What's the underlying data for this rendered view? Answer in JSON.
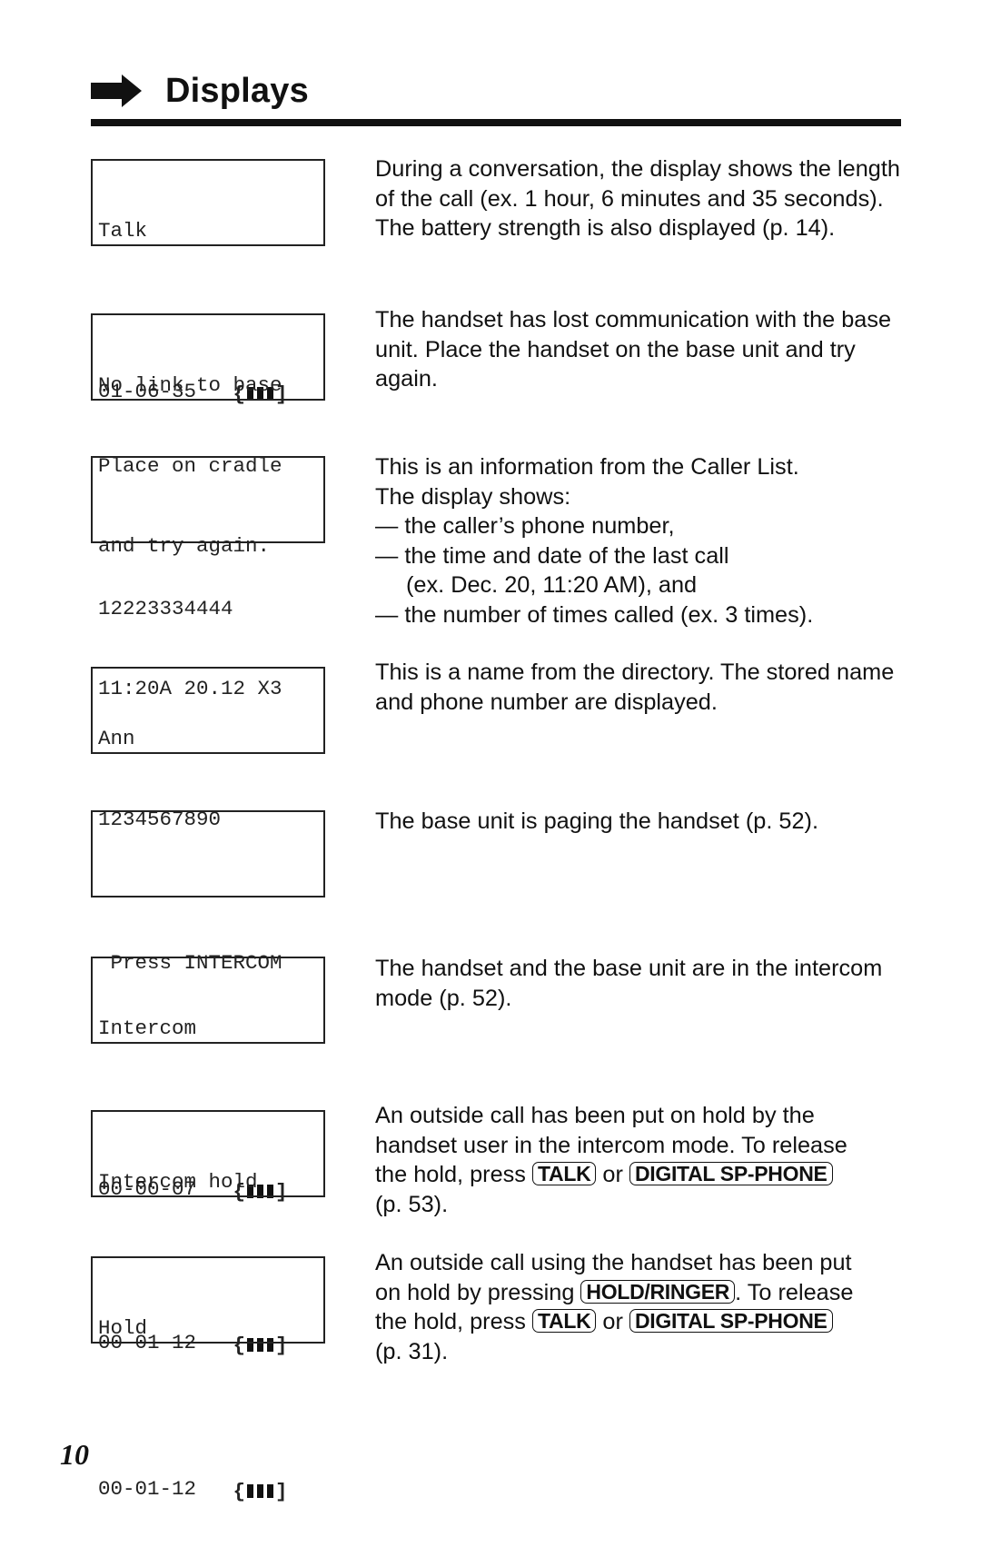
{
  "header": {
    "title": "Displays",
    "icon": "right-arrow-icon"
  },
  "entries": [
    {
      "lcd": [
        "Talk",
        "",
        "01-06-35   "
      ],
      "battery": true,
      "description": {
        "text": "During a conversation, the display shows the length of the call (ex. 1 hour, 6 minutes and 35 seconds). The battery strength is also displayed (p. 14)."
      }
    },
    {
      "lcd": [
        "No link to base",
        "Place on cradle",
        "and try again."
      ],
      "battery": false,
      "description": {
        "text": "The handset has lost communication with the base unit. Place the handset on the base unit and try again."
      }
    },
    {
      "lcd": [
        "",
        "12223334444",
        "11:20A 20.12 X3"
      ],
      "battery": false,
      "description": {
        "intro": [
          "This is an information from the Caller List.",
          "The display shows:"
        ],
        "items": [
          "— the caller’s phone number,",
          "— the time and date of the last call",
          "(ex. Dec. 20, 11:20 AM), and",
          "— the number of times called (ex. 3 times)."
        ]
      }
    },
    {
      "lcd": [
        "Ann",
        "1234567890",
        ""
      ],
      "battery": false,
      "description": {
        "text": "This is a name from the directory. The stored name and phone number are displayed."
      }
    },
    {
      "lcd": [
        "",
        " Press INTERCOM",
        ""
      ],
      "battery": false,
      "description": {
        "text": "The base unit is paging the handset (p. 52)."
      }
    },
    {
      "lcd": [
        "Intercom",
        "",
        "00-00-07   "
      ],
      "battery": true,
      "description": {
        "text": "The handset and the base unit are in the intercom mode (p. 52)."
      }
    },
    {
      "lcd": [
        "Intercom hold",
        "",
        "00-01-12   "
      ],
      "battery": true,
      "description": {
        "line1": "An outside call has been put on hold by the",
        "line2": "handset user in the intercom mode. To release",
        "line3_pre": "the hold, press ",
        "key1": "TALK",
        "line3_mid": " or ",
        "key2": "DIGITAL SP-PHONE",
        "line4": "(p. 53)."
      }
    },
    {
      "lcd": [
        "Hold",
        "",
        "00-01-12   "
      ],
      "battery": true,
      "description": {
        "line1": "An outside call using the handset has been put",
        "line2_pre": "on hold by pressing ",
        "key0": "HOLD/RINGER",
        "line2_post": ". To release",
        "line3_pre": "the hold, press ",
        "key1": "TALK",
        "line3_mid": " or ",
        "key2": "DIGITAL SP-PHONE",
        "line4": "(p. 31)."
      }
    }
  ],
  "battery_glyph": {
    "open": "{",
    "close": "]",
    "bars": 3
  },
  "footer": {
    "page_number": "10"
  }
}
